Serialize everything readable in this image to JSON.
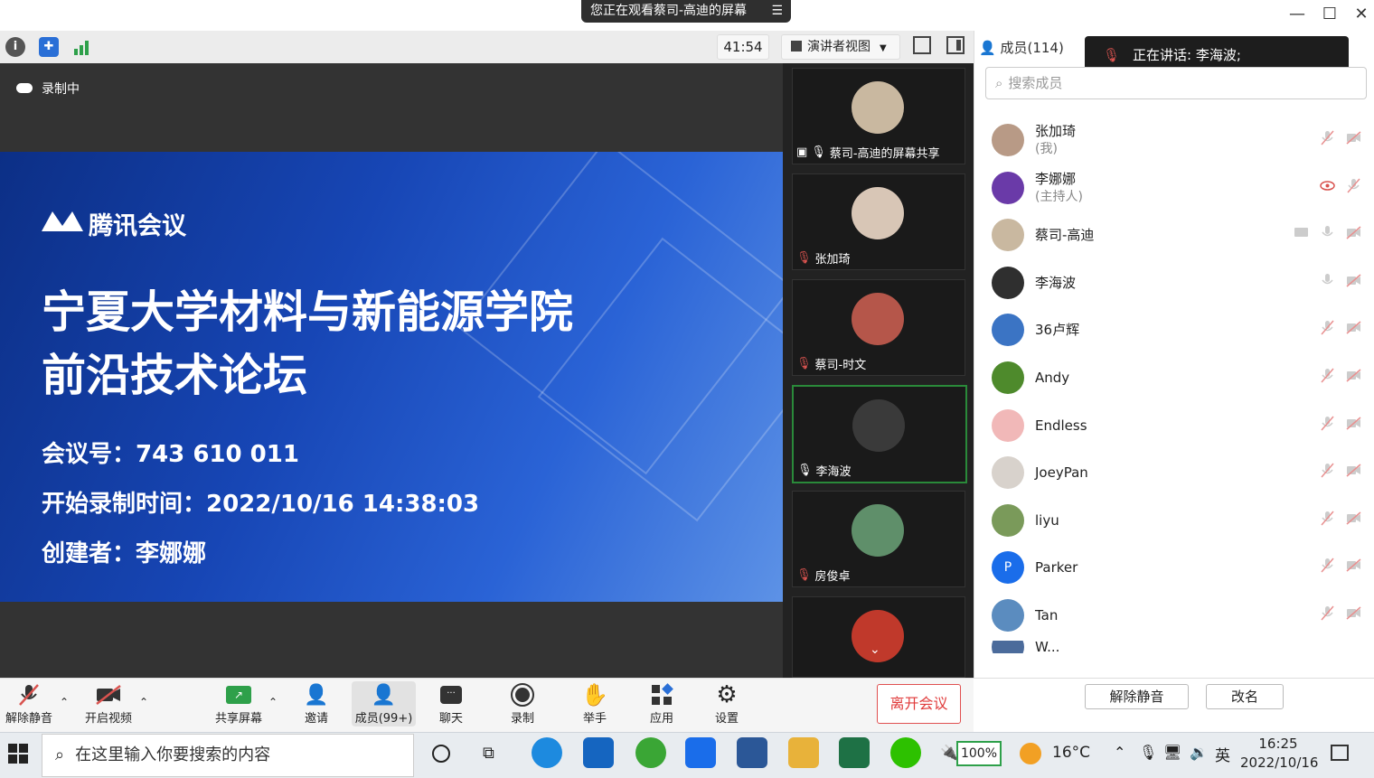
{
  "window": {
    "screen_banner": "您正在观看蔡司-高迪的屏幕"
  },
  "topbar": {
    "timer": "41:54",
    "view_mode": "演讲者视图"
  },
  "stage": {
    "recording_label": "录制中",
    "slide": {
      "logo_text": "腾讯会议",
      "title_line1": "宁夏大学材料与新能源学院",
      "title_line2": "前沿技术论坛",
      "meeting_id": "会议号：743 610 011",
      "record_start": "开始录制时间：2022/10/16 14:38:03",
      "creator": "创建者：李娜娜"
    }
  },
  "gallery": {
    "tiles": [
      {
        "name": "蔡司-高迪的屏幕共享",
        "avatar_color": "#c9b8a0"
      },
      {
        "name": "张加琦",
        "avatar_color": "#d8c6b6"
      },
      {
        "name": "蔡司-时文",
        "avatar_color": "#b5564a"
      },
      {
        "name": "李海波",
        "avatar_color": "#3a3a3a"
      },
      {
        "name": "房俊卓",
        "avatar_color": "#5f8f6a"
      },
      {
        "name": "",
        "avatar_color": "#c0392b"
      }
    ]
  },
  "panel": {
    "members_tab": "成员(114)",
    "speaking_label": "正在讲话: 李海波;",
    "search_placeholder": "搜索成员",
    "members": [
      {
        "name": "张加琦",
        "role": "(我)",
        "avatar_color": "#b89a86"
      },
      {
        "name": "李娜娜",
        "role": "(主持人)",
        "avatar_color": "#6a3aa8"
      },
      {
        "name": "蔡司-高迪",
        "role": "",
        "avatar_color": "#c9b8a0"
      },
      {
        "name": "李海波",
        "role": "",
        "avatar_color": "#2f2f2f"
      },
      {
        "name": "36卢辉",
        "role": "",
        "avatar_color": "#3b74c4"
      },
      {
        "name": "Andy",
        "role": "",
        "avatar_color": "#4e8a2c"
      },
      {
        "name": "Endless",
        "role": "",
        "avatar_color": "#f1b8b8"
      },
      {
        "name": "JoeyPan",
        "role": "",
        "avatar_color": "#d8d2cc"
      },
      {
        "name": "liyu",
        "role": "",
        "avatar_color": "#7a9a5a"
      },
      {
        "name": "Parker",
        "role": "",
        "avatar_color": "#1a6dea",
        "initial": "P"
      },
      {
        "name": "Tan",
        "role": "",
        "avatar_color": "#5b8cbf"
      },
      {
        "name": "W...",
        "role": "",
        "avatar_color": "#4b6b9b"
      }
    ],
    "unmute_all": "解除静音",
    "rename": "改名"
  },
  "bottombar": {
    "unmute": "解除静音",
    "start_video": "开启视频",
    "share_screen": "共享屏幕",
    "invite": "邀请",
    "members": "成员(99+)",
    "chat": "聊天",
    "record": "录制",
    "raise_hand": "举手",
    "apps": "应用",
    "settings": "设置",
    "leave": "离开会议"
  },
  "taskbar": {
    "search_placeholder": "在这里输入你要搜索的内容",
    "battery": "100%",
    "weather": "16°C",
    "ime": "英",
    "time": "16:25",
    "date": "2022/10/16"
  },
  "colors": {
    "accent_green": "#2a8a3a",
    "leave_red": "#e03a3a",
    "mute_red": "#d9534f"
  }
}
